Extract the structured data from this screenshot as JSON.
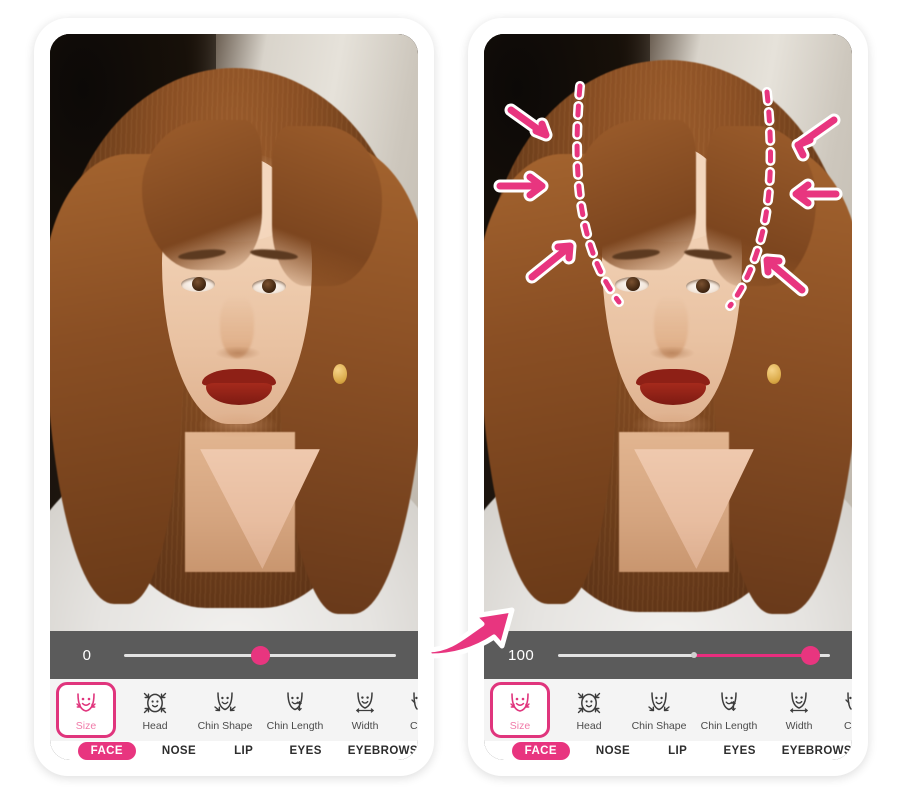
{
  "app": {
    "type": "photo-face-editor",
    "comparison": "before-after",
    "accent_color": "#e8357f",
    "slider_bar_color": "#5b5b5b",
    "tool_strip_color": "#f4f4f4",
    "page_background": "#ffffff"
  },
  "panels": [
    {
      "id": "before",
      "slider": {
        "value_label": "0",
        "value": 0,
        "min": -100,
        "max": 100,
        "knob_percent": 50,
        "fill_percent": 0,
        "fill_from_center": true
      },
      "tools": [
        {
          "label": "Size",
          "icon": "face-size-icon",
          "active": true
        },
        {
          "label": "Head",
          "icon": "head-resize-icon",
          "active": false
        },
        {
          "label": "Chin Shape",
          "icon": "chin-shape-icon",
          "active": false
        },
        {
          "label": "Chin Length",
          "icon": "chin-length-icon",
          "active": false
        },
        {
          "label": "Width",
          "icon": "face-width-icon",
          "active": false
        },
        {
          "label": "Cl",
          "icon": "cheek-icon",
          "active": false
        }
      ],
      "categories": [
        {
          "label": "FACE",
          "active": true
        },
        {
          "label": "NOSE",
          "active": false
        },
        {
          "label": "LIP",
          "active": false
        },
        {
          "label": "EYES",
          "active": false
        },
        {
          "label": "EYEBROWS",
          "active": false
        }
      ],
      "photo": {
        "subject": "young woman portrait, auburn hair, red lipstick, grey sweater"
      },
      "overlay_guides": false
    },
    {
      "id": "after",
      "slider": {
        "value_label": "100",
        "value": 100,
        "min": -100,
        "max": 100,
        "knob_percent": 93,
        "fill_percent": 93,
        "fill_from_center": true
      },
      "tools": [
        {
          "label": "Size",
          "icon": "face-size-icon",
          "active": true
        },
        {
          "label": "Head",
          "icon": "head-resize-icon",
          "active": false
        },
        {
          "label": "Chin Shape",
          "icon": "chin-shape-icon",
          "active": false
        },
        {
          "label": "Chin Length",
          "icon": "chin-length-icon",
          "active": false
        },
        {
          "label": "Width",
          "icon": "face-width-icon",
          "active": false
        },
        {
          "label": "Cl",
          "icon": "cheek-icon",
          "active": false
        }
      ],
      "categories": [
        {
          "label": "FACE",
          "active": true
        },
        {
          "label": "NOSE",
          "active": false
        },
        {
          "label": "LIP",
          "active": false
        },
        {
          "label": "EYES",
          "active": false
        },
        {
          "label": "EYEBROWS",
          "active": false
        }
      ],
      "photo": {
        "subject": "young woman portrait, auburn hair, red lipstick, grey sweater"
      },
      "overlay_guides": true,
      "guide_annotation": {
        "dashed_outline_color": "#e8357f",
        "dashed_outline_halo": "#ffffff",
        "arrow_color": "#e8357f",
        "arrow_outline": "#ffffff",
        "left_arrow_count": 3,
        "right_arrow_count": 3,
        "meaning": "face slimming inward"
      }
    }
  ],
  "transition": {
    "icon": "right-arrow-icon",
    "color": "#e8357f",
    "outline": "#ffffff"
  }
}
